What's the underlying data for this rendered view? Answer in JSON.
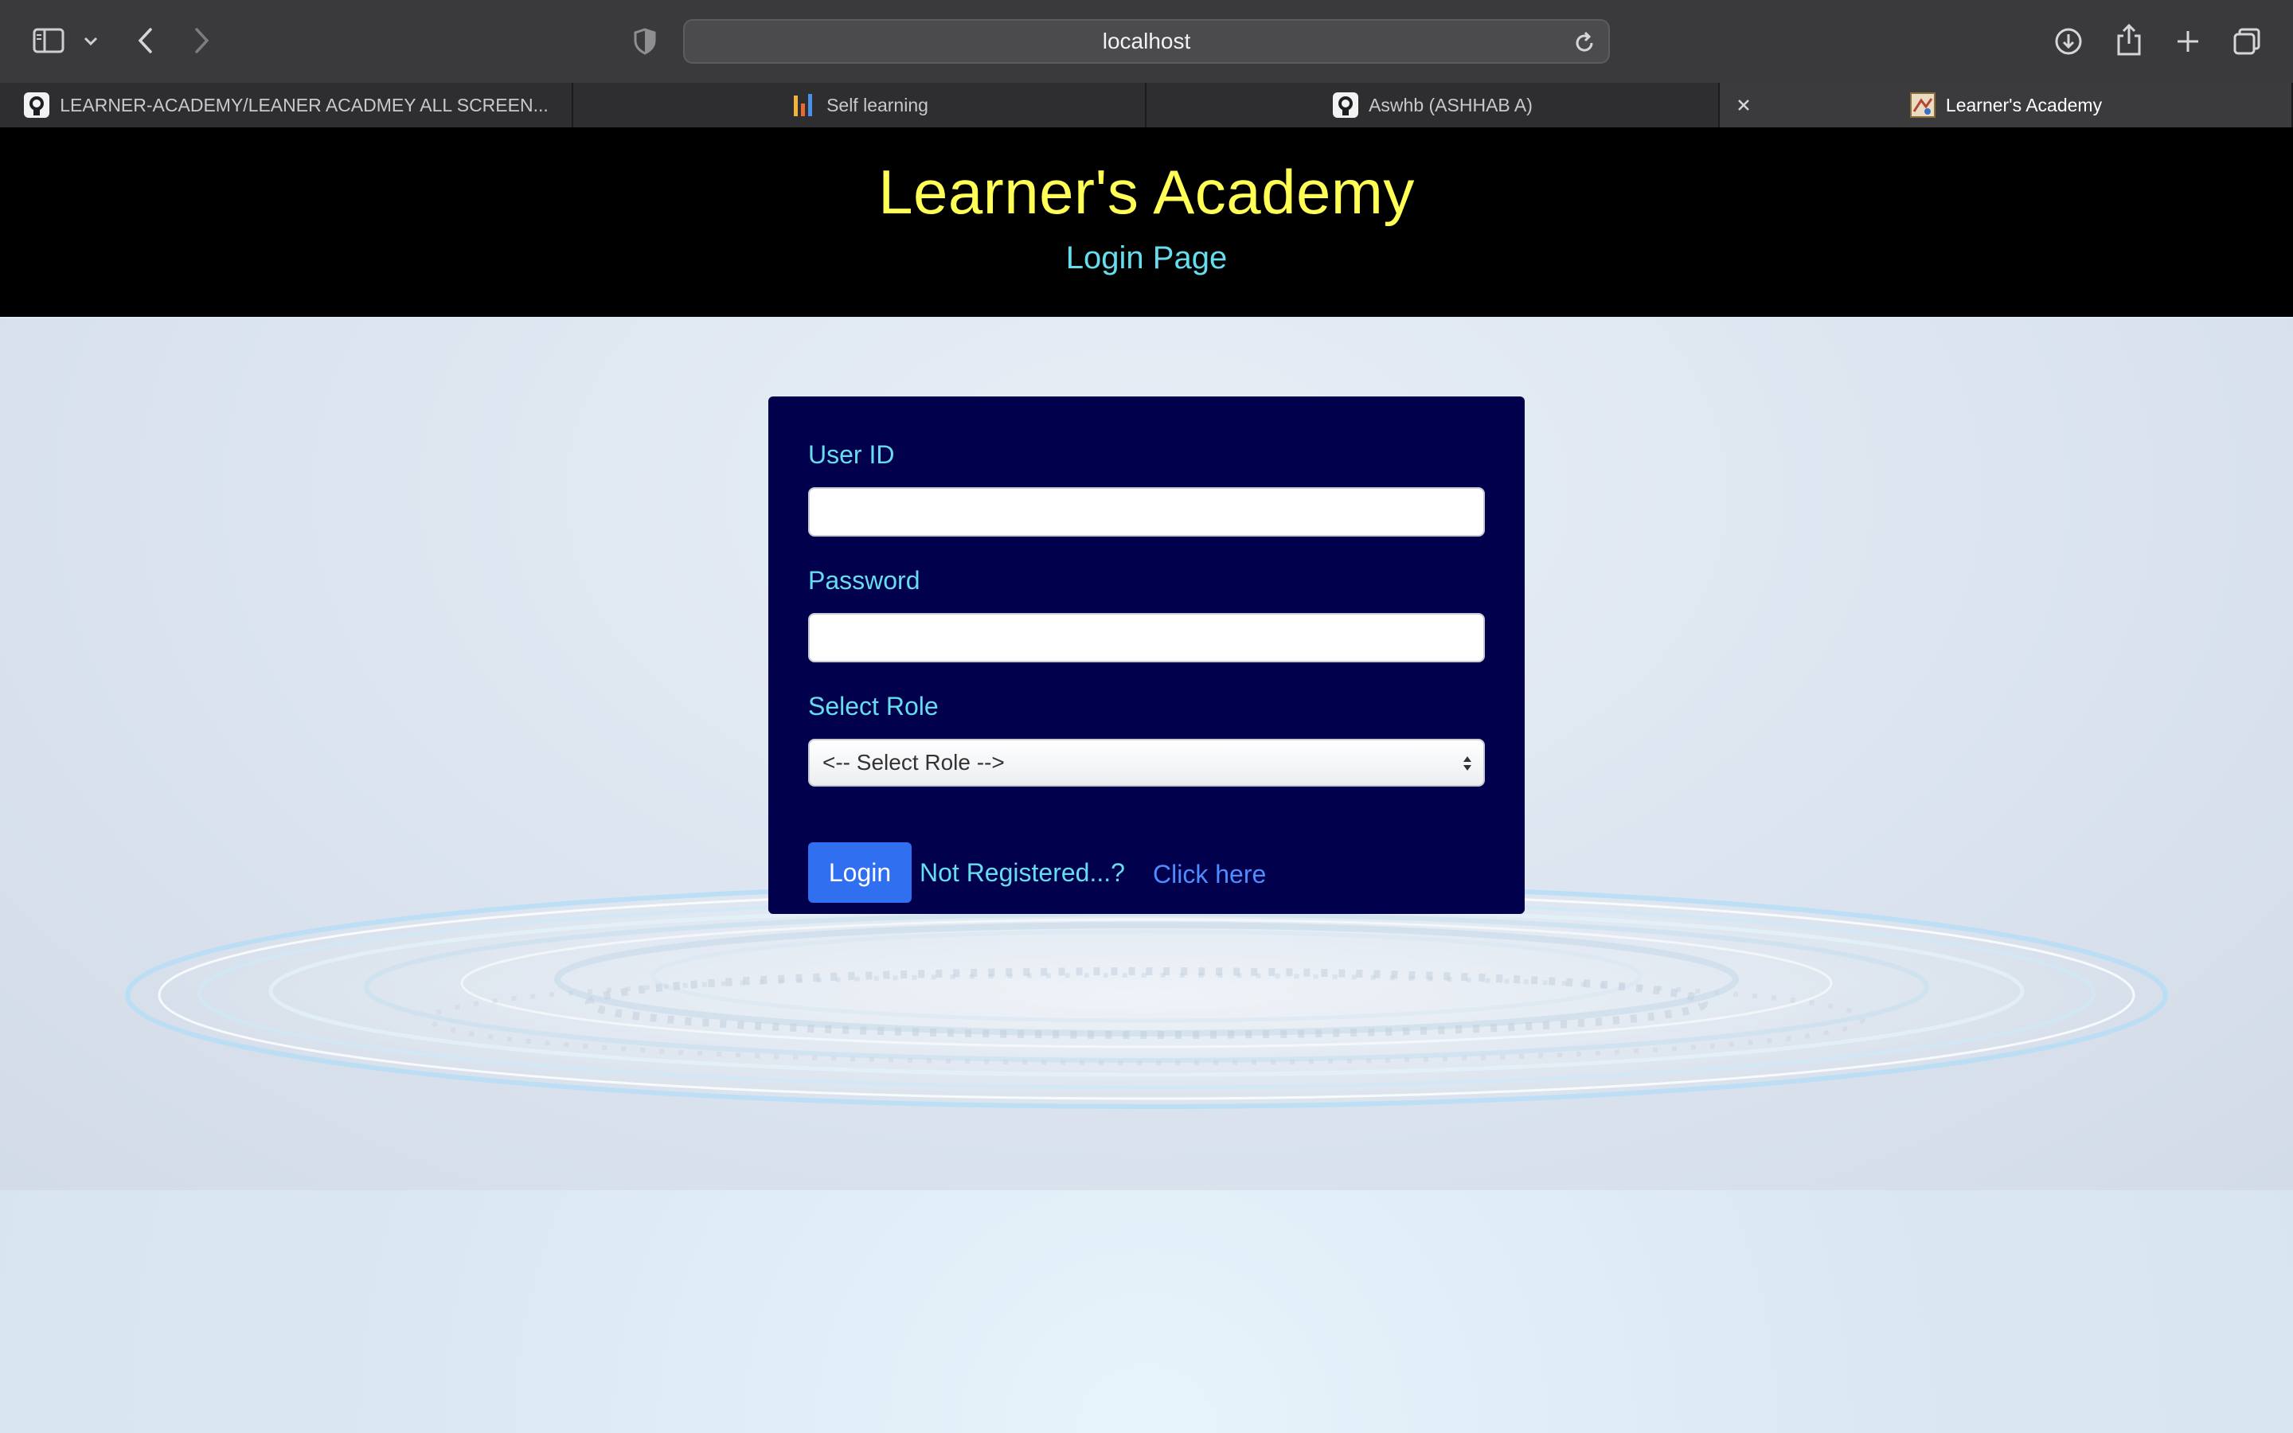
{
  "browser": {
    "address": "localhost",
    "tabs": [
      {
        "label": "LEARNER-ACADEMY/LEANER ACADMEY ALL SCREEN...",
        "icon": "github-icon",
        "active": false
      },
      {
        "label": "Self learning",
        "icon": "bars-icon",
        "active": false
      },
      {
        "label": "Aswhb (ASHHAB A)",
        "icon": "github-icon",
        "active": false
      },
      {
        "label": "Learner's Academy",
        "icon": "site-favicon",
        "active": true
      }
    ]
  },
  "header": {
    "title": "Learner's Academy",
    "subtitle": "Login Page"
  },
  "login": {
    "user_id_label": "User ID",
    "user_id_value": "",
    "password_label": "Password",
    "password_value": "",
    "role_label": "Select Role",
    "role_selected": "<-- Select Role -->",
    "login_button": "Login",
    "not_registered": "Not Registered...?",
    "click_here": "Click here"
  },
  "colors": {
    "title_yellow": "#ffff55",
    "subtitle_cyan": "#66ddee",
    "card_navy": "#00004d",
    "button_blue": "#2f6ff0",
    "link_blue": "#4f8cff"
  }
}
